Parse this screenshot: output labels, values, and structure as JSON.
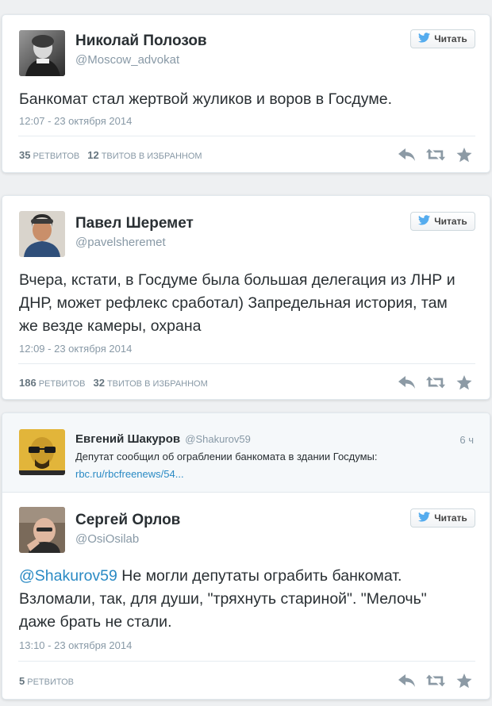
{
  "colors": {
    "bird_blue": "#55acee",
    "mention_blue": "#2a8ac4",
    "icon_gray": "#8c9aa5"
  },
  "tweets": [
    {
      "name": "Николай Полозов",
      "handle": "@Moscow_advokat",
      "follow_label": "Читать",
      "text": "Банкомат стал жертвой жуликов и воров в Госдуме.",
      "timestamp": "12:07 - 23 октября 2014",
      "retweets_count": "35",
      "retweets_label": "РЕТВИТОВ",
      "favorites_count": "12",
      "favorites_label": "ТВИТОВ В ИЗБРАННОМ"
    },
    {
      "name": "Павел Шеремет",
      "handle": "@pavelsheremet",
      "follow_label": "Читать",
      "text": "Вчера, кстати, в Госдуме была большая делегация из ЛНР и ДНР, может рефлекс сработал) Запредельная история, там же везде камеры, охрана",
      "timestamp": "12:09 - 23 октября 2014",
      "retweets_count": "186",
      "retweets_label": "РЕТВИТОВ",
      "favorites_count": "32",
      "favorites_label": "ТВИТОВ В ИЗБРАННОМ"
    },
    {
      "reply_to": {
        "name": "Евгений Шакуров",
        "handle": "@Shakurov59",
        "time": "6 ч",
        "text": "Депутат сообщил об ограблении банкомата в здании Госдумы:",
        "link": "rbc.ru/rbcfreenews/54..."
      },
      "name": "Сергей Орлов",
      "handle": "@OsiOsilab",
      "follow_label": "Читать",
      "mention": "@Shakurov59",
      "text": " Не могли депутаты ограбить банкомат. Взломали, так, для души, \"тряхнуть стариной\". \"Мелочь\" даже брать не стали.",
      "timestamp": "13:10 - 23 октября 2014",
      "retweets_count": "5",
      "retweets_label": "РЕТВИТОВ"
    }
  ],
  "icons": {
    "follow": "twitter-bird-icon",
    "reply": "reply-icon",
    "retweet": "retweet-icon",
    "favorite": "star-icon"
  }
}
